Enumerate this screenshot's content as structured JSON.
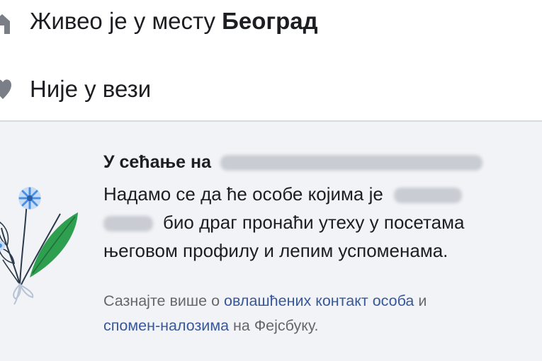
{
  "profile": {
    "lived_in": {
      "prefix": "Живео је у месту ",
      "place": "Београд",
      "icon": "home-icon"
    },
    "relationship": {
      "status": "Није у вези",
      "icon": "heart-icon"
    }
  },
  "memorial": {
    "title_prefix": "У сећање на",
    "body_line1": "Надамо се да ће особе којима је",
    "body_line2": "био драг пронаћи утеху у посетама",
    "body_line3": "његовом профилу и лепим успоменама.",
    "learn_prefix": "Сазнајте више о ",
    "link_legacy_contact": "овлашћених контакт особа",
    "learn_and": " и",
    "link_memorialized": "спомен-налозима",
    "learn_suffix": " на Фејсбуку.",
    "icon": "flowers-illustration"
  },
  "colors": {
    "link": "#385898",
    "muted_text": "#65676b",
    "panel_background": "#f2f3f6",
    "flower_blue": "#4a90e2",
    "leaf_green": "#2e9e4f"
  }
}
